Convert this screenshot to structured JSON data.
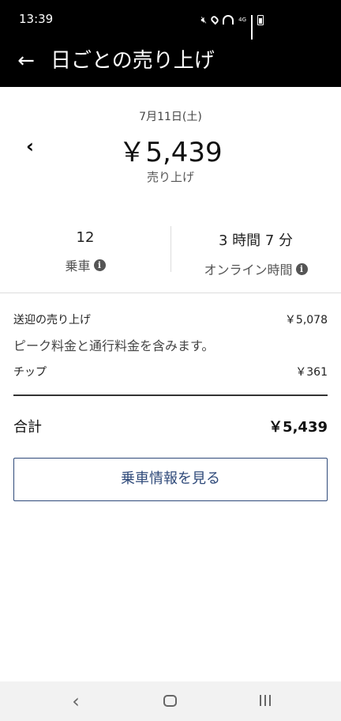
{
  "status_bar": {
    "time": "13:39",
    "network": "4G",
    "icons": [
      "mute-icon",
      "location-icon",
      "wifi-icon",
      "signal-icon",
      "battery-icon"
    ]
  },
  "header": {
    "back_icon": "arrow-left-icon",
    "title": "日ごとの売り上げ"
  },
  "summary": {
    "date": "7月11日(土)",
    "prev_icon": "chevron-left-icon",
    "amount": "￥5,439",
    "caption": "売り上げ"
  },
  "stats": [
    {
      "value": "12",
      "label": "乗車",
      "info_icon": "info-icon"
    },
    {
      "value": "3 時間 7 分",
      "label": "オンライン時間",
      "info_icon": "info-icon"
    }
  ],
  "breakdown": {
    "fare_label": "送迎の売り上げ",
    "fare_value": "￥5,078",
    "fare_note": "ピーク料金と通行料金を含みます。",
    "tip_label": "チップ",
    "tip_value": "￥361",
    "total_label": "合計",
    "total_value": "￥5,439"
  },
  "cta": {
    "label": "乗車情報を見る"
  },
  "nav_bar": {
    "icons": [
      "nav-back-icon",
      "nav-home-icon",
      "nav-recents-icon"
    ]
  },
  "colors": {
    "header_bg": "#000000",
    "accent": "#2f4a7a",
    "nav_bar_bg": "#f2f2f2"
  }
}
